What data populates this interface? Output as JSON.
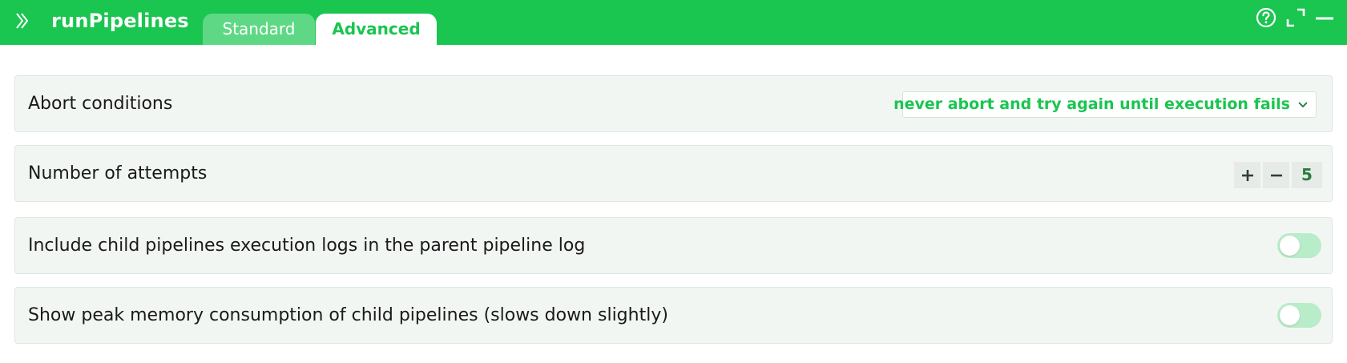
{
  "header": {
    "title": "runPipelines",
    "tabs": [
      {
        "label": "Standard",
        "active": false
      },
      {
        "label": "Advanced",
        "active": true
      }
    ],
    "icons": [
      "expand-icon",
      "help-icon",
      "fullscreen-icon",
      "minimize-icon"
    ],
    "accent_color": "#1ac550"
  },
  "settings": {
    "abort_conditions": {
      "label": "Abort conditions",
      "selected": "never abort and try again until execution fails"
    },
    "attempts": {
      "label": "Number of attempts",
      "value": "5"
    },
    "include_child_logs": {
      "label": "Include child pipelines execution logs in the parent pipeline log",
      "enabled": false
    },
    "peak_memory": {
      "label": "Show peak memory consumption of child pipelines (slows down slightly)",
      "enabled": false
    }
  }
}
